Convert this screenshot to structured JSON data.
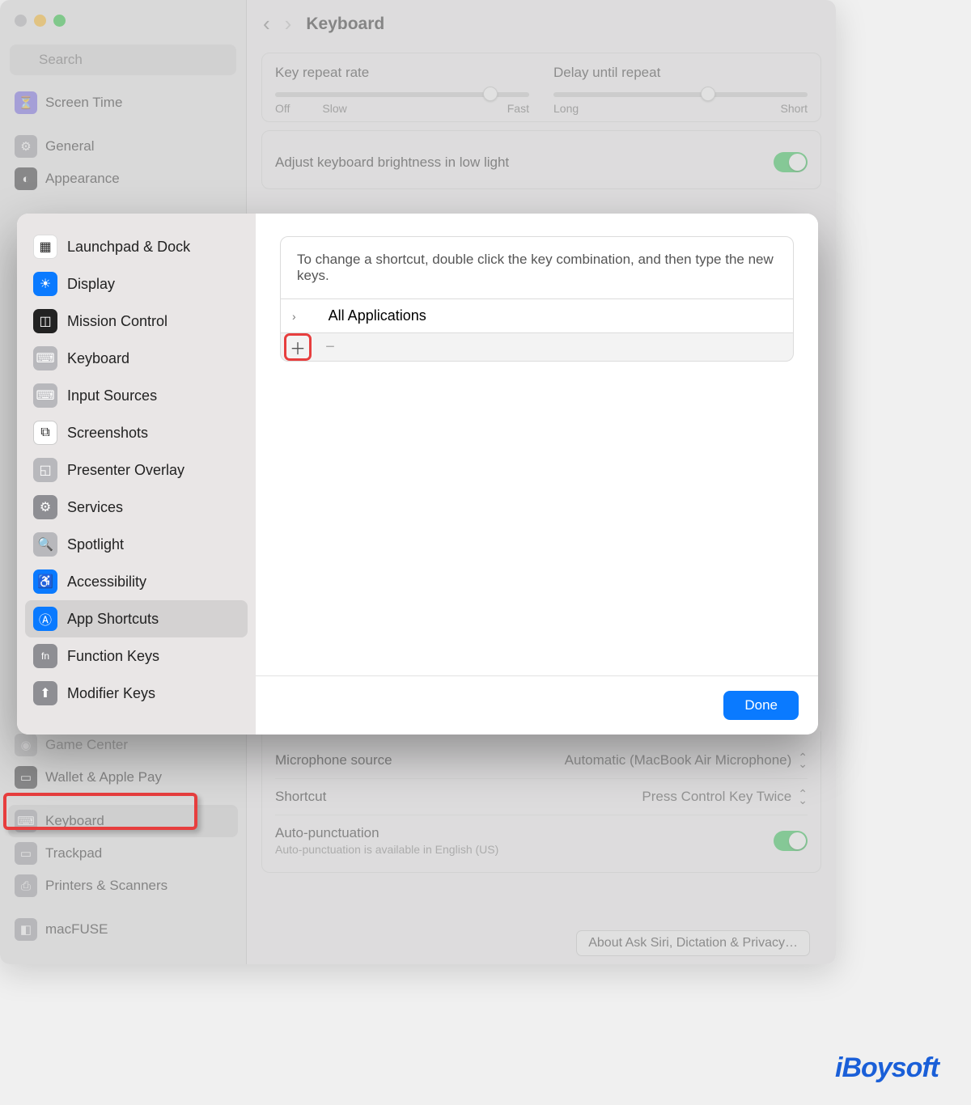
{
  "header": {
    "title": "Keyboard"
  },
  "search": {
    "placeholder": "Search"
  },
  "sidebar": {
    "items": [
      {
        "label": "Screen Time",
        "color": "#7a6de8",
        "glyph": "⏳"
      },
      {
        "label": "General",
        "color": "#a3a3a8",
        "glyph": "⚙"
      },
      {
        "label": "Appearance",
        "color": "#3b3b3d",
        "glyph": "◐"
      },
      {
        "label": "Game Center",
        "color": "#a3a3a8",
        "glyph": "🎮"
      },
      {
        "label": "Wallet & Apple Pay",
        "color": "#3b3b3d",
        "glyph": "💳"
      },
      {
        "label": "Keyboard",
        "color": "#a3a3a8",
        "glyph": "⌨"
      },
      {
        "label": "Trackpad",
        "color": "#a3a3a8",
        "glyph": "▭"
      },
      {
        "label": "Printers & Scanners",
        "color": "#a3a3a8",
        "glyph": "🖨"
      },
      {
        "label": "macFUSE",
        "color": "#a3a3a8",
        "glyph": "◧"
      }
    ]
  },
  "sliders": {
    "repeat": {
      "title": "Key repeat rate",
      "left": "Off",
      "left2": "Slow",
      "right": "Fast"
    },
    "delay": {
      "title": "Delay until repeat",
      "left": "Long",
      "right": "Short"
    }
  },
  "rows": {
    "brightness": "Adjust keyboard brightness in low light",
    "mic_label": "Microphone source",
    "mic_value": "Automatic (MacBook Air Microphone)",
    "shortcut_label": "Shortcut",
    "shortcut_value": "Press Control Key Twice",
    "auto_label": "Auto-punctuation",
    "auto_sub": "Auto-punctuation is available in English (US)"
  },
  "sheet": {
    "items": [
      {
        "label": "Launchpad & Dock",
        "color": "#ffffff",
        "glyph": "▦"
      },
      {
        "label": "Display",
        "color": "#0a7aff",
        "glyph": "☀"
      },
      {
        "label": "Mission Control",
        "color": "#222",
        "glyph": "◫"
      },
      {
        "label": "Keyboard",
        "color": "#b8b8bc",
        "glyph": "⌨"
      },
      {
        "label": "Input Sources",
        "color": "#b8b8bc",
        "glyph": "⌨"
      },
      {
        "label": "Screenshots",
        "color": "#ffffff",
        "glyph": "⧉"
      },
      {
        "label": "Presenter Overlay",
        "color": "#b8b8bc",
        "glyph": "◱"
      },
      {
        "label": "Services",
        "color": "#8e8e93",
        "glyph": "⚙"
      },
      {
        "label": "Spotlight",
        "color": "#b8b8bc",
        "glyph": "🔍"
      },
      {
        "label": "Accessibility",
        "color": "#0a7aff",
        "glyph": "♿"
      },
      {
        "label": "App Shortcuts",
        "color": "#0a7aff",
        "glyph": "⬡"
      },
      {
        "label": "Function Keys",
        "color": "#8e8e93",
        "glyph": "fn"
      },
      {
        "label": "Modifier Keys",
        "color": "#8e8e93",
        "glyph": "⬆"
      }
    ],
    "instruction": "To change a shortcut, double click the key combination, and then type the new keys.",
    "all_apps": "All Applications",
    "done": "Done"
  },
  "footer_button": "About Ask Siri, Dictation & Privacy…",
  "watermark": "iBoysoft"
}
